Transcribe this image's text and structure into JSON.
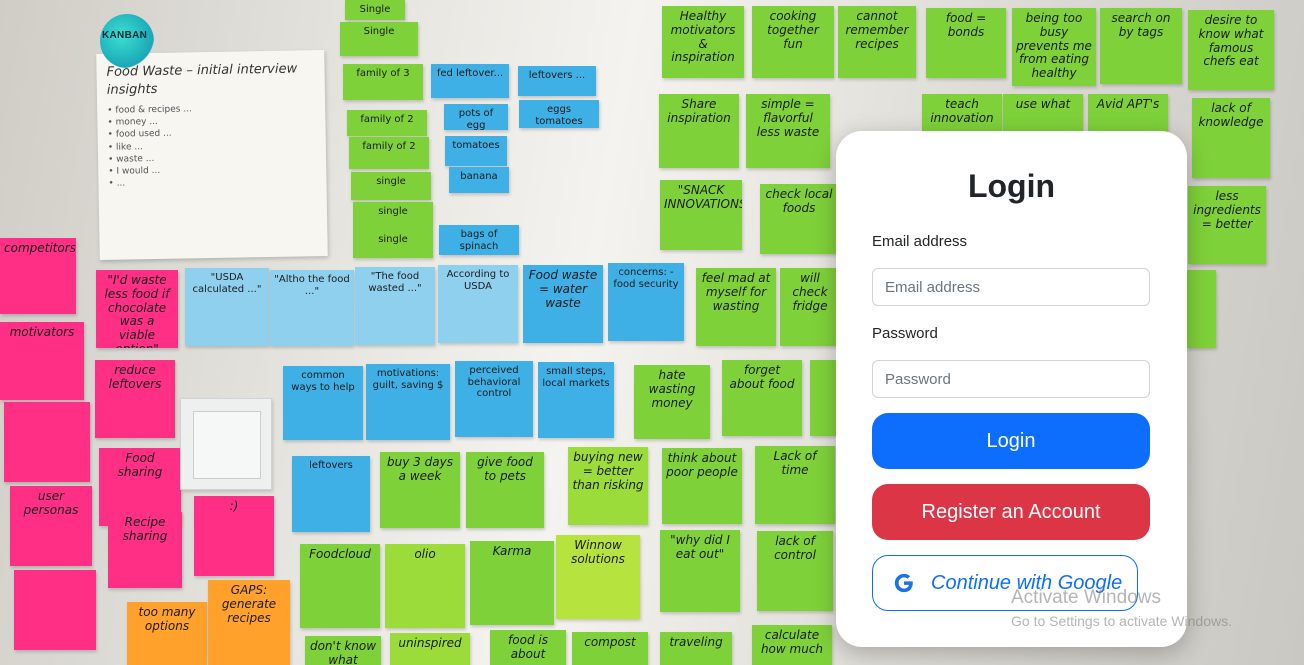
{
  "brand": {
    "logo_text": "KANBAN"
  },
  "login": {
    "title": "Login",
    "email_label": "Email address",
    "email_placeholder": "Email address",
    "email_value": "",
    "password_label": "Password",
    "password_placeholder": "Password",
    "password_value": "",
    "login_button": "Login",
    "register_button": "Register an Account",
    "google_button": "Continue with Google"
  },
  "watermark": {
    "line1": "Activate Windows",
    "line2": "Go to Settings to activate Windows."
  },
  "colors": {
    "primary": "#0d6efd",
    "danger": "#dc3545",
    "card_bg": "#ffffff",
    "sticky_green": "#7fd13a",
    "sticky_blue": "#3fb0e6",
    "sticky_pink": "#ff2f86",
    "sticky_orange": "#ffa12b"
  },
  "icons": {
    "google": "google-g-icon"
  }
}
